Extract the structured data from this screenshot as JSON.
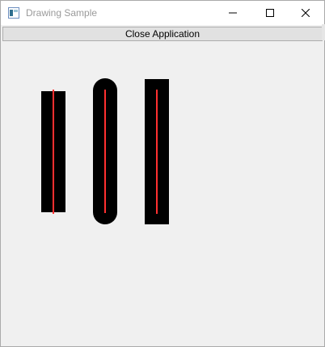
{
  "window": {
    "title": "Drawing Sample",
    "controls": {
      "minimize": "minimize-icon",
      "maximize": "maximize-icon",
      "close": "close-icon"
    }
  },
  "toolbar": {
    "close_app_label": "Close Application"
  },
  "drawing": {
    "shapes": [
      {
        "name": "square-cap-line",
        "fill": "#000000",
        "center_line": "#ff3030"
      },
      {
        "name": "round-cap-line",
        "fill": "#000000",
        "center_line": "#ff3030"
      },
      {
        "name": "projecting-cap-line",
        "fill": "#000000",
        "center_line": "#ff3030"
      }
    ]
  },
  "colors": {
    "background": "#f0f0f0",
    "stroke": "#000000",
    "guide": "#ff3030"
  }
}
